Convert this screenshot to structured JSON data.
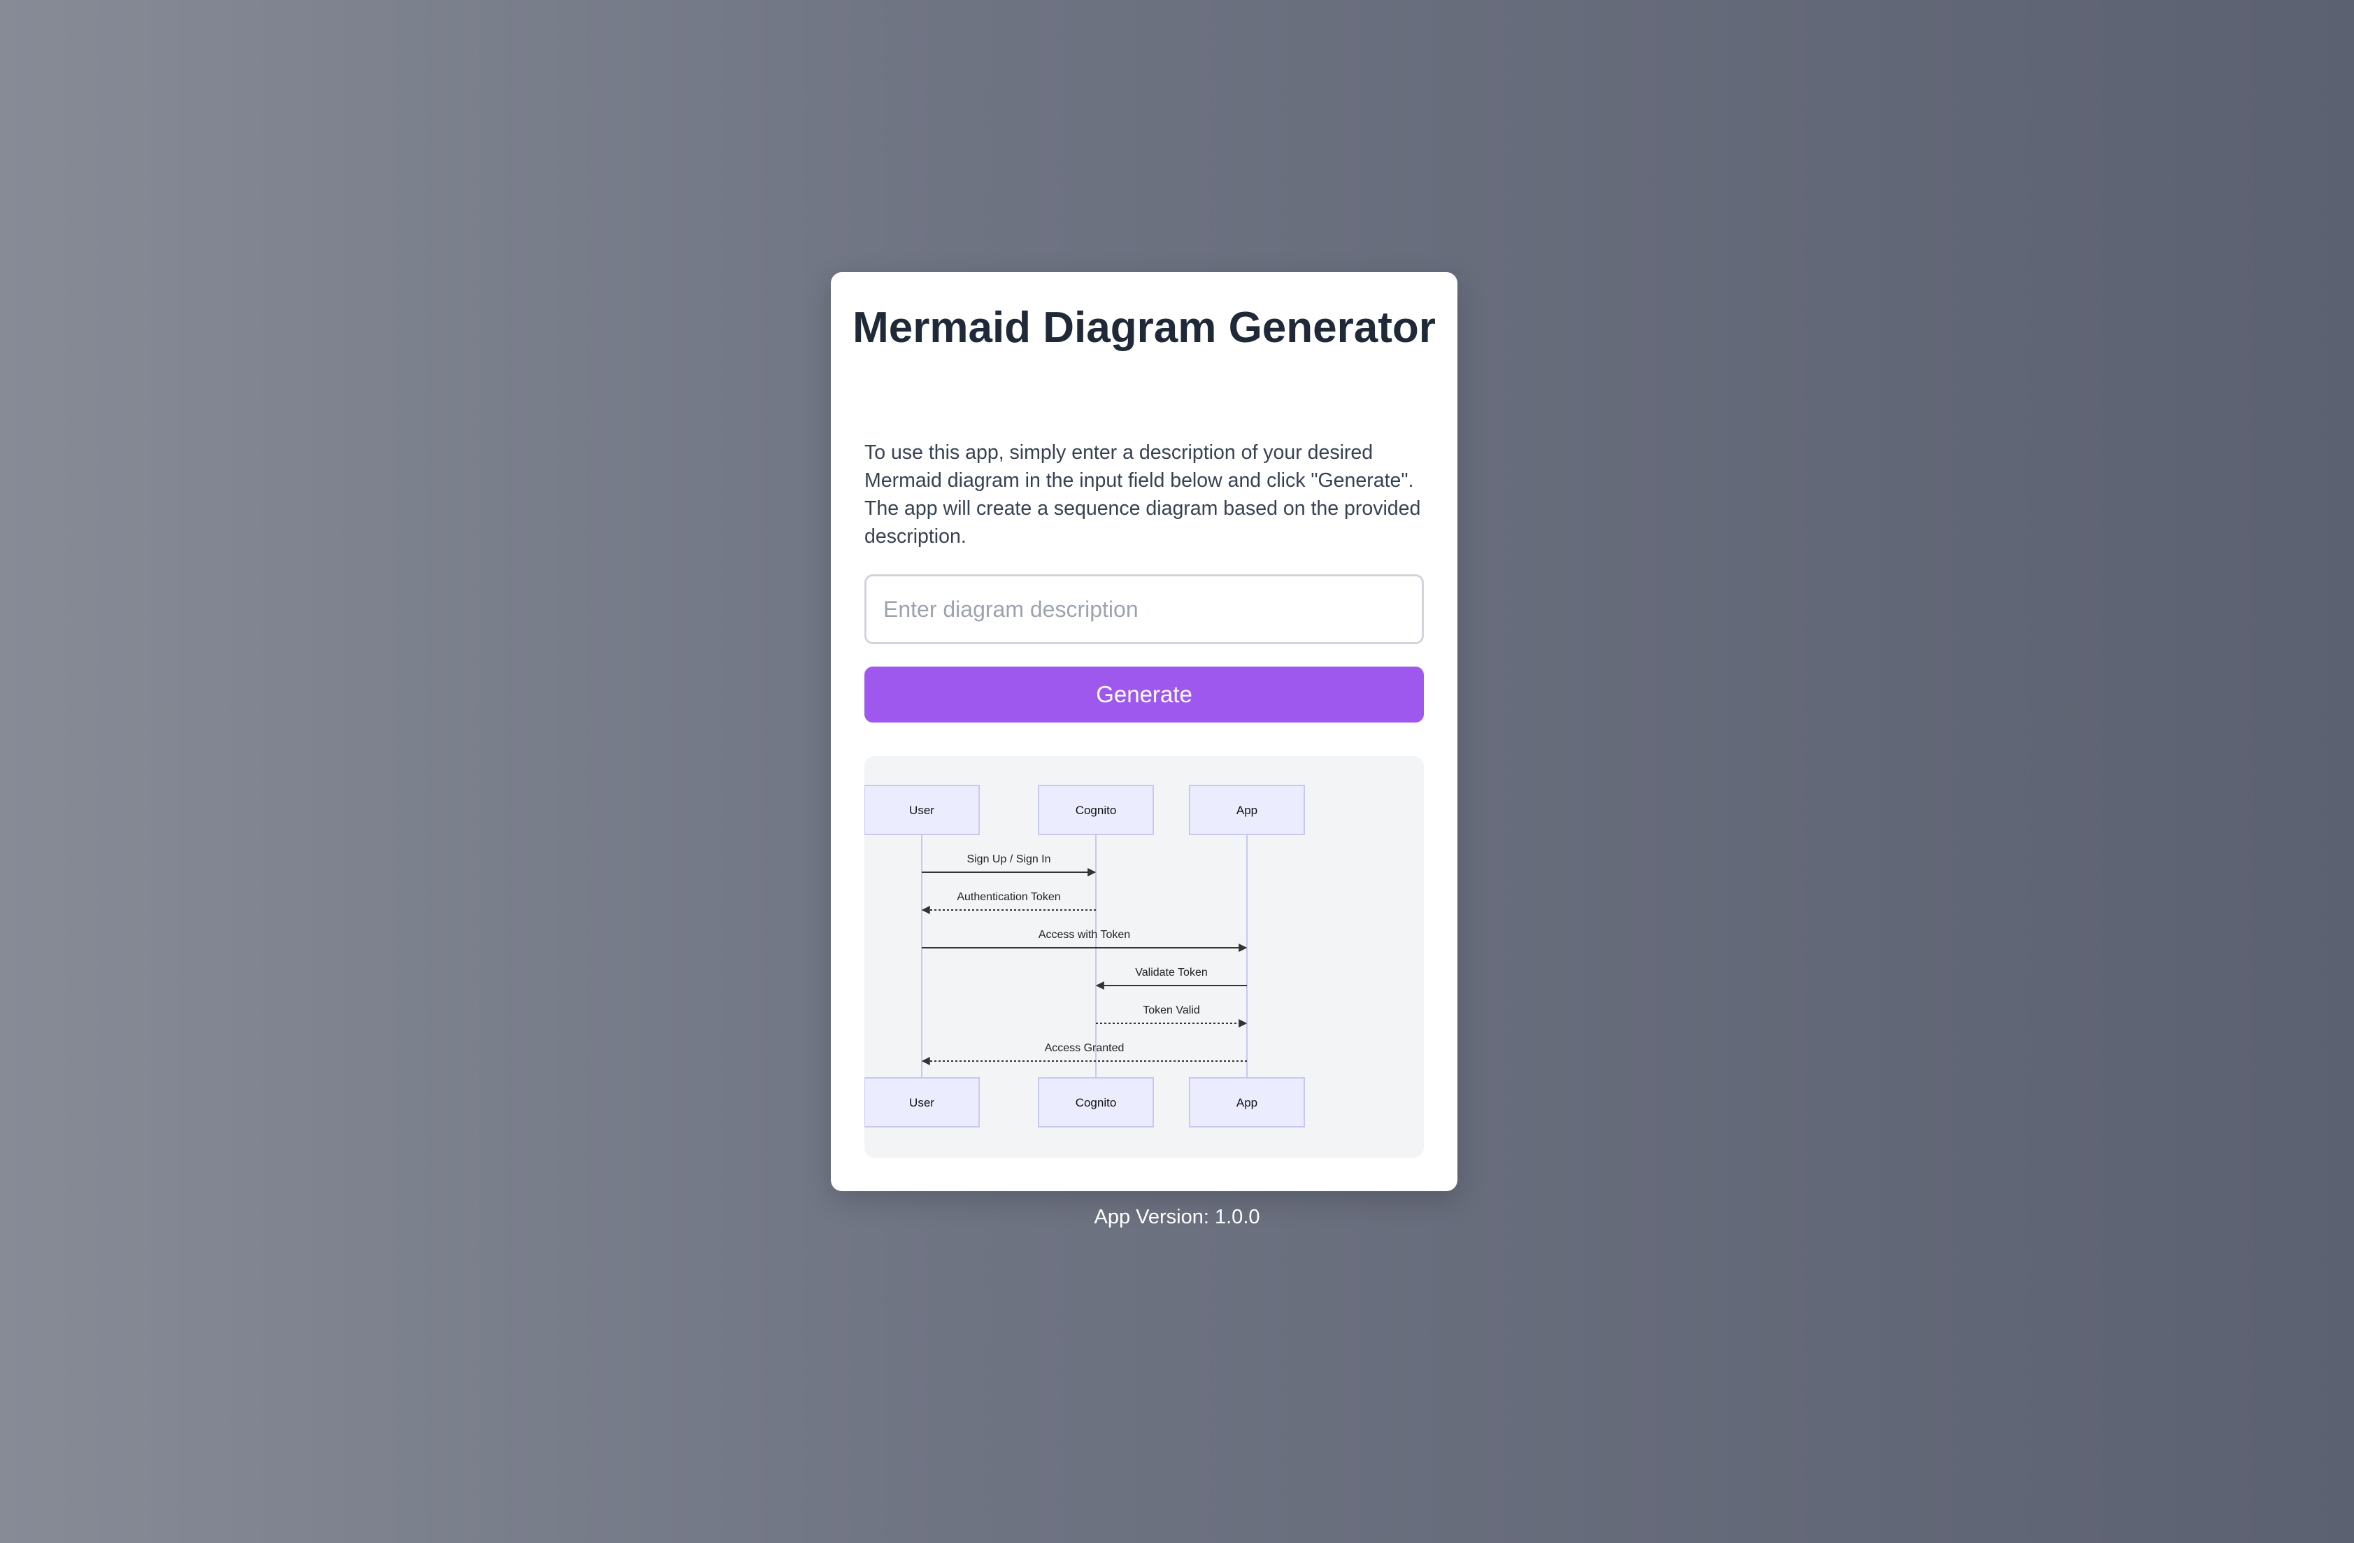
{
  "app": {
    "title": "Mermaid Diagram Generator",
    "description": "To use this app, simply enter a description of your desired Mermaid diagram in the input field below and click \"Generate\". The app will create a sequence diagram based on the provided description.",
    "input": {
      "value": "",
      "placeholder": "Enter diagram description"
    },
    "generate_label": "Generate",
    "version_text": "App Version: 1.0.0"
  },
  "colors": {
    "accent": "#9f58ee",
    "card_background": "#ffffff",
    "diagram_background": "#f3f4f6",
    "actor_fill": "#ececff",
    "actor_stroke": "#c9c9f0",
    "arrow": "#333333"
  },
  "diagram": {
    "type": "sequence",
    "actors": [
      "User",
      "Cognito",
      "App"
    ],
    "messages": [
      {
        "from": "User",
        "to": "Cognito",
        "label": "Sign Up / Sign In",
        "style": "solid"
      },
      {
        "from": "Cognito",
        "to": "User",
        "label": "Authentication Token",
        "style": "dotted"
      },
      {
        "from": "User",
        "to": "App",
        "label": "Access with Token",
        "style": "solid"
      },
      {
        "from": "App",
        "to": "Cognito",
        "label": "Validate Token",
        "style": "solid"
      },
      {
        "from": "Cognito",
        "to": "App",
        "label": "Token Valid",
        "style": "dotted"
      },
      {
        "from": "App",
        "to": "User",
        "label": "Access Granted",
        "style": "dotted"
      }
    ]
  }
}
